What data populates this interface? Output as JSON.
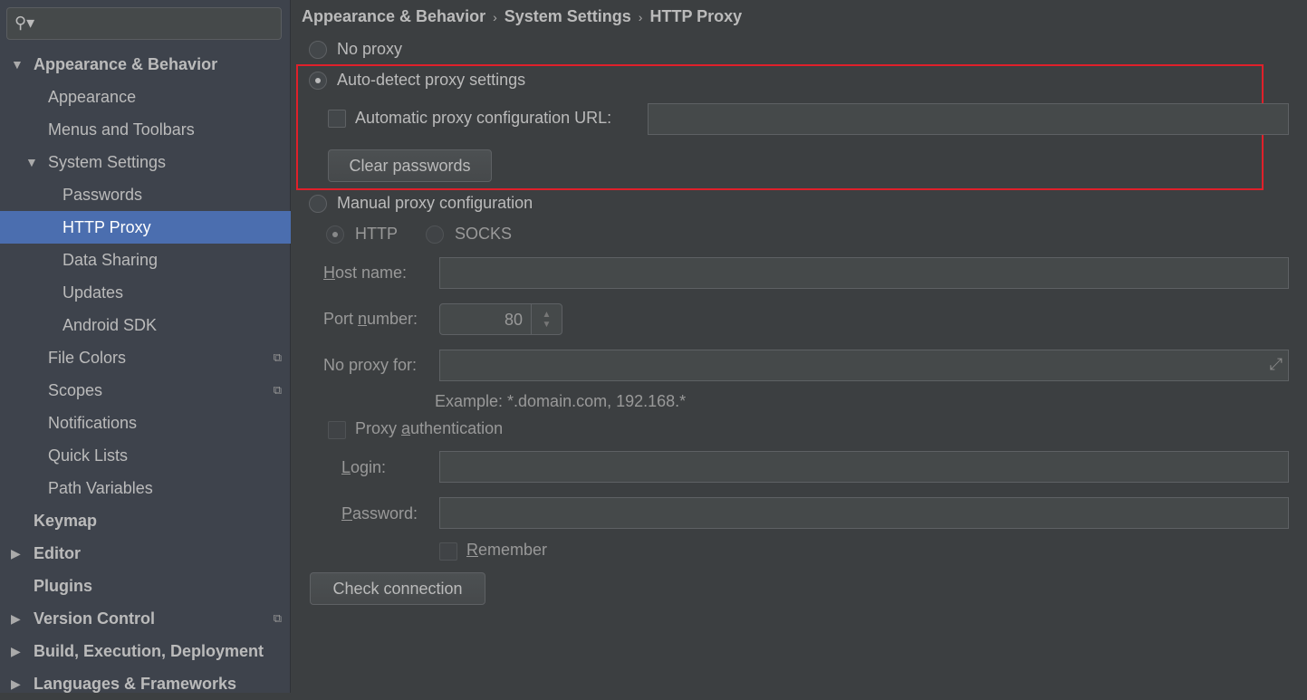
{
  "search": {
    "icon": "search-icon"
  },
  "sidebar": {
    "items": [
      {
        "label": "Appearance & Behavior",
        "bold": true,
        "arrow": "down"
      },
      {
        "label": "Appearance"
      },
      {
        "label": "Menus and Toolbars"
      },
      {
        "label": "System Settings",
        "arrow": "down"
      },
      {
        "label": "Passwords"
      },
      {
        "label": "HTTP Proxy",
        "selected": true
      },
      {
        "label": "Data Sharing"
      },
      {
        "label": "Updates"
      },
      {
        "label": "Android SDK"
      },
      {
        "label": "File Colors",
        "copy": true
      },
      {
        "label": "Scopes",
        "copy": true
      },
      {
        "label": "Notifications"
      },
      {
        "label": "Quick Lists"
      },
      {
        "label": "Path Variables"
      },
      {
        "label": "Keymap",
        "bold": true
      },
      {
        "label": "Editor",
        "bold": true,
        "arrow": "right"
      },
      {
        "label": "Plugins",
        "bold": true
      },
      {
        "label": "Version Control",
        "bold": true,
        "arrow": "right",
        "copy": true
      },
      {
        "label": "Build, Execution, Deployment",
        "bold": true,
        "arrow": "right"
      },
      {
        "label": "Languages & Frameworks",
        "bold": true,
        "arrow": "right"
      }
    ]
  },
  "breadcrumb": [
    "Appearance & Behavior",
    "System Settings",
    "HTTP Proxy"
  ],
  "proxy": {
    "no_proxy": "No proxy",
    "auto_detect": "Auto-detect proxy settings",
    "auto_url_label": "Automatic proxy configuration URL:",
    "auto_url_value": "",
    "clear_passwords": "Clear passwords",
    "manual": "Manual proxy configuration",
    "http": "HTTP",
    "socks": "SOCKS",
    "host": {
      "m": "H",
      "rest": "ost name:"
    },
    "port": {
      "pre": "Port ",
      "m": "n",
      "rest": "umber:",
      "value": "80"
    },
    "no_proxy_for": "No proxy for:",
    "example": "Example: *.domain.com, 192.168.*",
    "auth": {
      "pre": "Proxy ",
      "m": "a",
      "rest": "uthentication"
    },
    "login": {
      "m": "L",
      "rest": "ogin:"
    },
    "password": {
      "m": "P",
      "rest": "assword:"
    },
    "remember": {
      "m": "R",
      "rest": "emember"
    },
    "check_connection": "Check connection",
    "selected_mode": "auto-detect",
    "highlight_color": "#e0202a",
    "selection_color": "#4b6eaf"
  }
}
